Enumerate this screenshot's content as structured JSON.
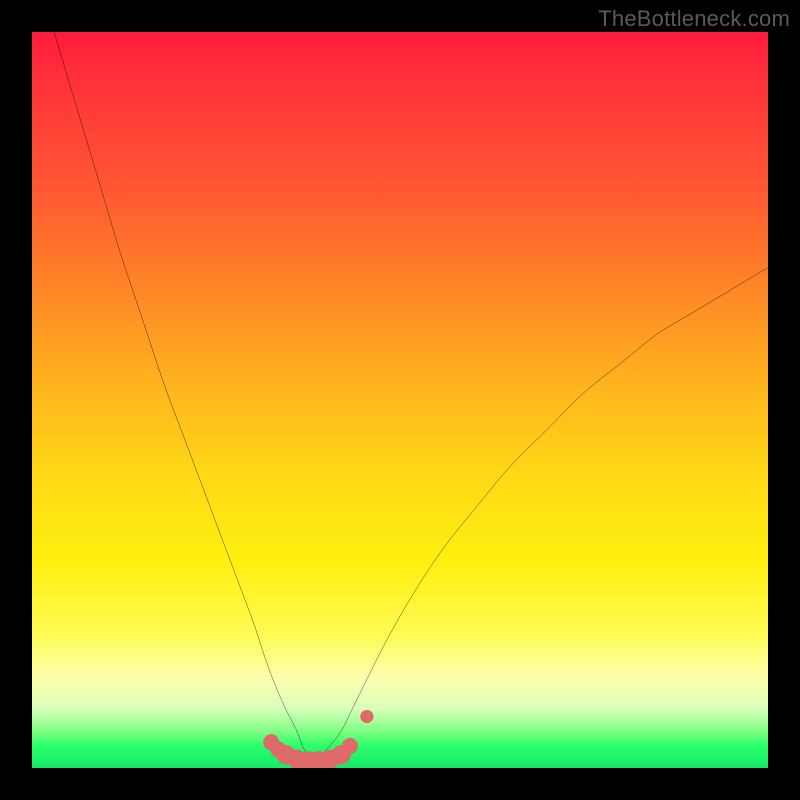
{
  "attribution": "TheBottleneck.com",
  "colors": {
    "frame": "#000000",
    "curve": "#000000",
    "marker": "#e06a6a",
    "gradient_top": "#ff1a3c",
    "gradient_bottom": "#16e86a"
  },
  "chart_data": {
    "type": "line",
    "title": "",
    "xlabel": "",
    "ylabel": "",
    "xlim": [
      0,
      100
    ],
    "ylim": [
      0,
      100
    ],
    "grid": false,
    "legend": false,
    "series": [
      {
        "name": "bottleneck-curve",
        "x": [
          3,
          6,
          9,
          12,
          15,
          18,
          21,
          24,
          27,
          30,
          32,
          34,
          36,
          37,
          38.5,
          40,
          42,
          44,
          48,
          52,
          56,
          60,
          65,
          70,
          75,
          80,
          85,
          90,
          95,
          100
        ],
        "y": [
          100,
          90,
          80,
          70,
          61,
          52,
          44,
          36,
          28,
          20,
          14,
          9,
          5,
          2.5,
          1,
          2.5,
          5,
          9,
          17,
          24,
          30,
          35,
          41,
          46,
          51,
          55,
          59,
          62,
          65,
          68
        ]
      }
    ],
    "markers": {
      "name": "trough-markers",
      "color": "#e06a6a",
      "points": [
        {
          "x": 32.5,
          "y": 3.5,
          "r": 1.1
        },
        {
          "x": 33.5,
          "y": 2.5,
          "r": 1.1
        },
        {
          "x": 34.5,
          "y": 1.8,
          "r": 1.3
        },
        {
          "x": 36,
          "y": 1.2,
          "r": 1.3
        },
        {
          "x": 37.5,
          "y": 1.0,
          "r": 1.3
        },
        {
          "x": 39,
          "y": 1.0,
          "r": 1.3
        },
        {
          "x": 40.5,
          "y": 1.2,
          "r": 1.3
        },
        {
          "x": 42,
          "y": 1.8,
          "r": 1.3
        },
        {
          "x": 43.2,
          "y": 3.0,
          "r": 1.1
        },
        {
          "x": 45.5,
          "y": 7.0,
          "r": 0.9
        }
      ]
    }
  }
}
